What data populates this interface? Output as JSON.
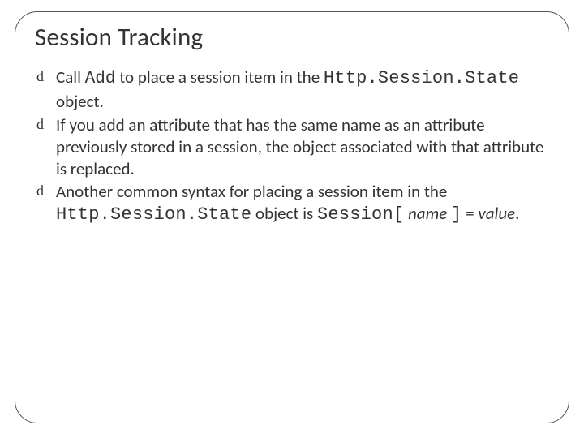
{
  "title": "Session Tracking",
  "bullets": [
    {
      "pre": "Call ",
      "code1": "Add",
      "mid1": " to place a session item in the ",
      "code2": "Http.Session.State",
      "post": " object."
    },
    {
      "text": "If you add an attribute that has the same name as an attribute previously stored in a session, the object associated with that attribute is replaced."
    },
    {
      "pre": "Another common syntax for placing a session item in the ",
      "code1": "Http.Session.State",
      "mid1": " object is ",
      "code2": "Session[",
      "ital1": " name ",
      "code3": "]",
      "mid2": " = ",
      "ital2": "value",
      "post": "."
    }
  ]
}
